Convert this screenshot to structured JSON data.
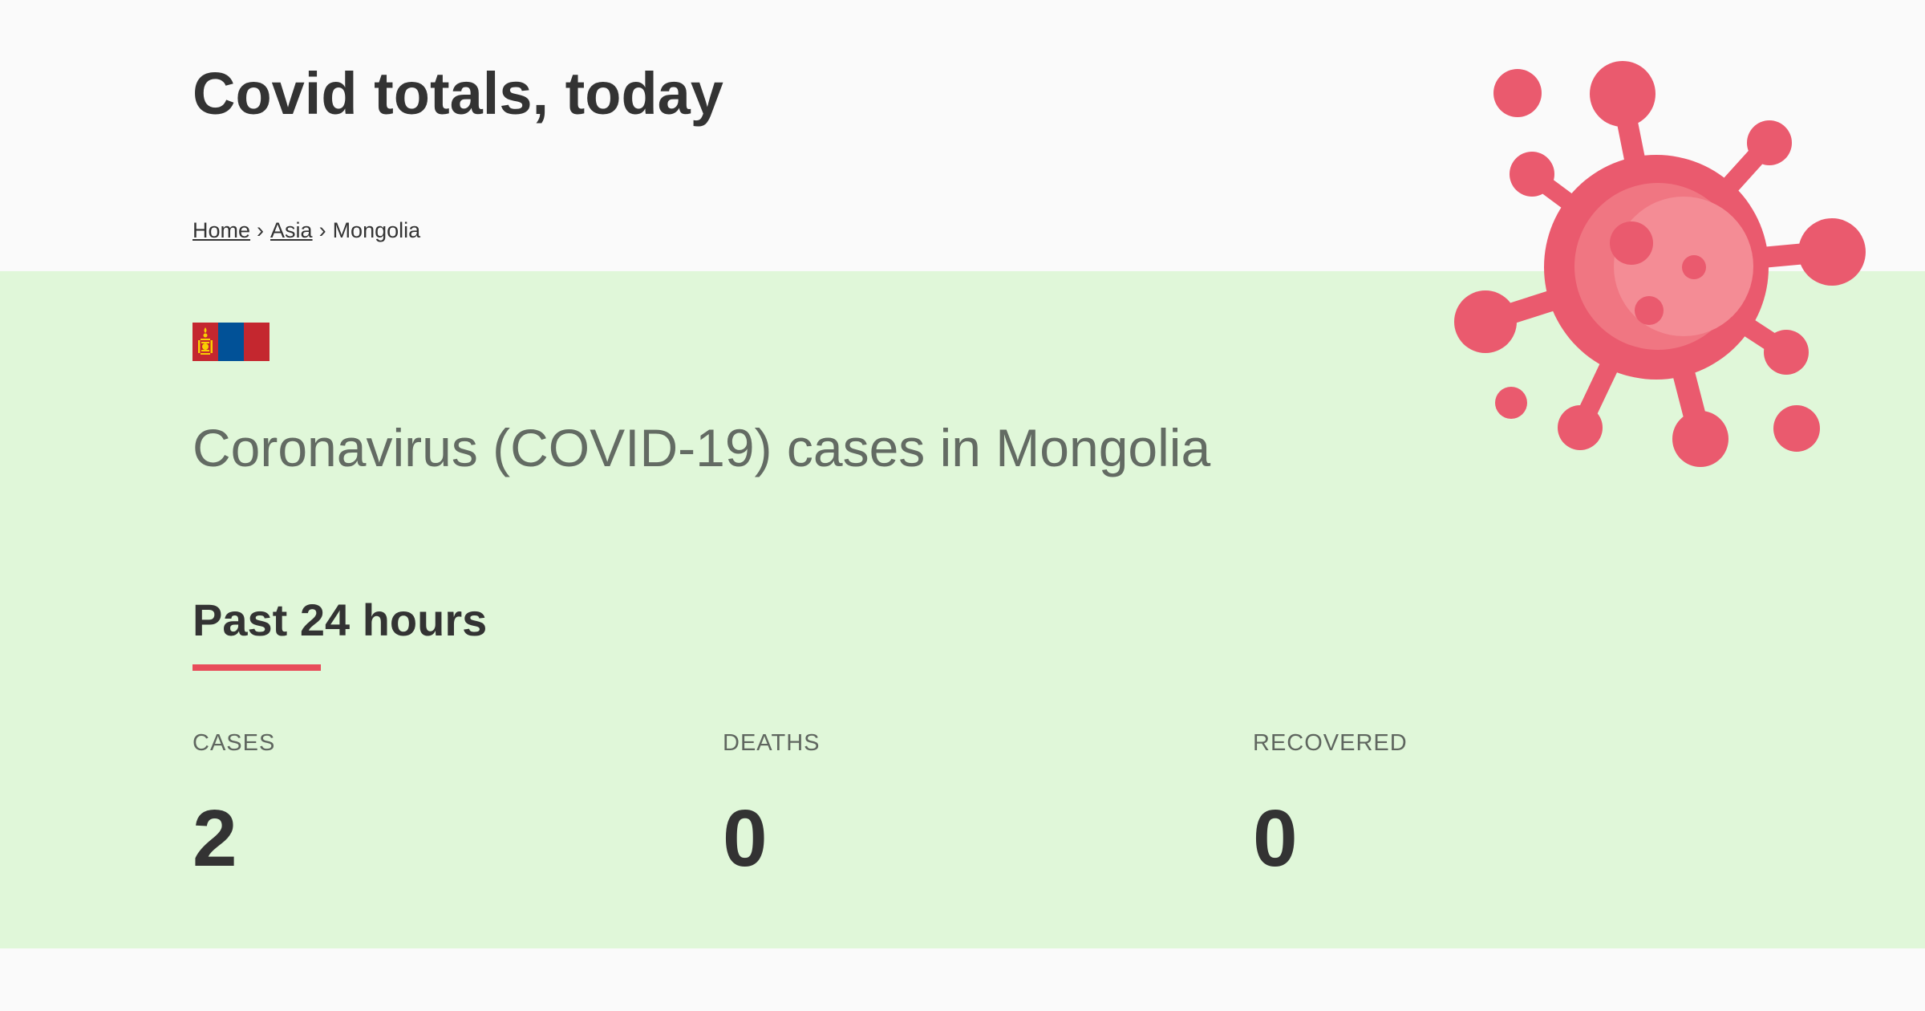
{
  "header": {
    "title": "Covid totals, today",
    "breadcrumb": {
      "home": "Home",
      "separator": "›",
      "region": "Asia",
      "current": "Mongolia"
    }
  },
  "main": {
    "flag_icon": "mongolia-flag-icon",
    "country_title": "Coronavirus (COVID-19) cases in Mongolia",
    "section_title": "Past 24 hours",
    "stats": [
      {
        "label": "CASES",
        "value": "2"
      },
      {
        "label": "DEATHS",
        "value": "0"
      },
      {
        "label": "RECOVERED",
        "value": "0"
      }
    ]
  },
  "decoration": {
    "illustration": "virus-icon"
  },
  "colors": {
    "page_background": "#fafafa",
    "main_background": "#e0f7d9",
    "accent": "#e84c5a",
    "virus_dark": "#ea5a6e",
    "virus_light": "#f48c95",
    "flag_red": "#c4272f",
    "flag_blue": "#015197",
    "flag_gold": "#f9cf02"
  }
}
